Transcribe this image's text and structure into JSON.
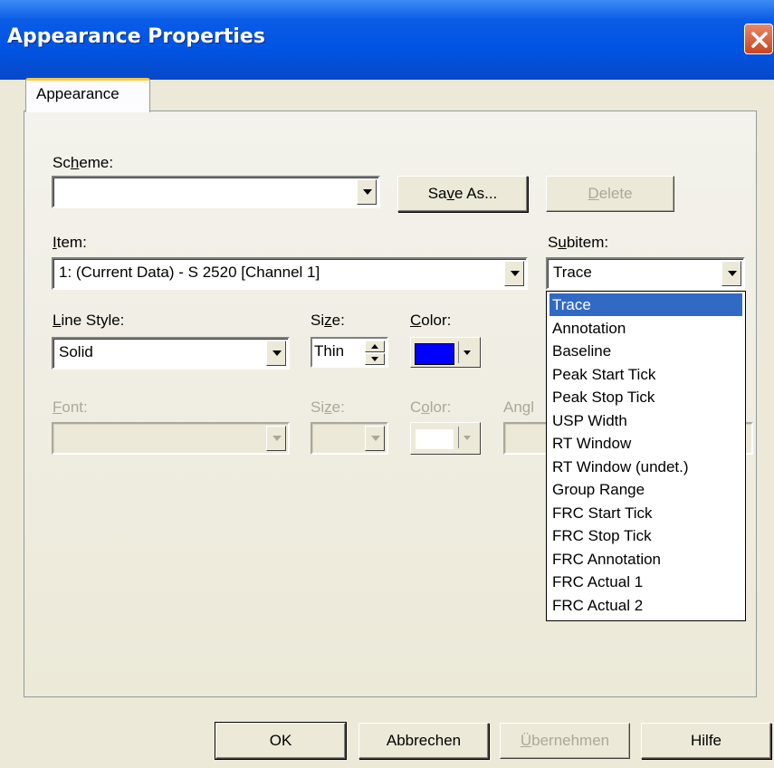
{
  "window": {
    "title": "Appearance Properties",
    "close_glyph": "✕"
  },
  "tabs": [
    {
      "label": "Appearance"
    }
  ],
  "scheme": {
    "label": "Scheme:",
    "value": "",
    "save_as_label": "Save As...",
    "delete_label": "Delete"
  },
  "item": {
    "label": "Item:",
    "value": "1: (Current Data) - S 2520 [Channel 1]"
  },
  "subitem": {
    "label": "Subitem:",
    "value": "Trace",
    "options": [
      "Trace",
      "Annotation",
      "Baseline",
      "Peak Start Tick",
      "Peak Stop Tick",
      "USP Width",
      "RT Window",
      "RT Window (undet.)",
      "Group Range",
      "FRC Start Tick",
      "FRC Stop Tick",
      "FRC Annotation",
      "FRC Actual 1",
      "FRC Actual 2"
    ],
    "selected_index": 0
  },
  "line": {
    "style_label": "Line Style:",
    "style_value": "Solid",
    "size_label": "Size:",
    "size_value": "Thin",
    "color_label": "Color:",
    "color_value": "#0000ff"
  },
  "font": {
    "font_label": "Font:",
    "size_label": "Size:",
    "color_label": "Color:",
    "angle_label": "Angle"
  },
  "buttons": {
    "ok": "OK",
    "cancel": "Abbrechen",
    "apply": "Übernehmen",
    "help": "Hilfe"
  },
  "colors": {
    "title_bar": "#0054e3",
    "selection": "#316ac5",
    "dialog_bg": "#ece9d8"
  }
}
